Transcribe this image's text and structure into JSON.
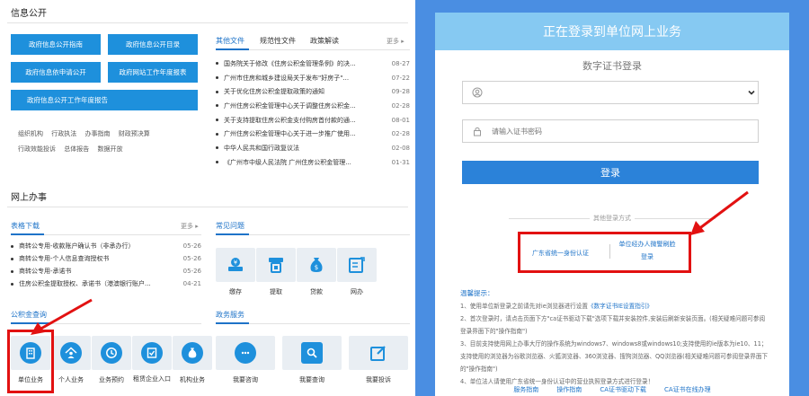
{
  "info_public": {
    "title": "信息公开",
    "buttons": [
      "政府信息公开指南",
      "政府信息公开目录",
      "政府信息依申请公开",
      "政府网站工作年度报表",
      "政府信息公开工作年度报告"
    ],
    "links_row1": [
      "组织机构",
      "行政执法",
      "办事指南",
      "财政预决算"
    ],
    "links_row2": [
      "行政效能投诉",
      "总体报告",
      "数据开放"
    ]
  },
  "news": {
    "tabs": [
      "其他文件",
      "规范性文件",
      "政策解读"
    ],
    "more": "更多 ▸",
    "items": [
      {
        "title": "国务院关于修改《住房公积金管理条例》的决...",
        "date": "08-27"
      },
      {
        "title": "广州市住房和城乡建设局关于发布\"好房子\"...",
        "date": "07-22"
      },
      {
        "title": "关于优化住房公积金提取政策的通知",
        "date": "09-28"
      },
      {
        "title": "广州住房公积金管理中心关于调整住房公积金...",
        "date": "02-28"
      },
      {
        "title": "关于支持提取住房公积金支付购房首付款的通...",
        "date": "08-01"
      },
      {
        "title": "广州住房公积金管理中心关于进一步推广使用...",
        "date": "02-28"
      },
      {
        "title": "中华人民共和国行政复议法",
        "date": "02-08"
      },
      {
        "title": "《广州市中级人民法院 广州住房公积金管理...",
        "date": "01-31"
      }
    ]
  },
  "online": {
    "title": "网上办事",
    "forms_tab": "表格下载",
    "faq_tab": "常见问题",
    "more": "更多 ▸",
    "forms": [
      {
        "title": "商转公专用-收款账户确认书（非承办行）",
        "date": "05-26"
      },
      {
        "title": "商转公专用-个人信息查询授权书",
        "date": "05-26"
      },
      {
        "title": "商转公专用-承诺书",
        "date": "05-26"
      },
      {
        "title": "住房公积金提取授权、承诺书（港澳银行账户...",
        "date": "04-21"
      }
    ],
    "faq": [
      "缴存",
      "提取",
      "贷款",
      "网办"
    ]
  },
  "gjj_query": {
    "title": "公积金查询",
    "items": [
      "单位业务",
      "个人业务",
      "业务预约",
      "租赁企业入口",
      "机构业务"
    ]
  },
  "gov_service": {
    "title": "政务服务",
    "items": [
      "我要咨询",
      "我要查询",
      "我要投诉"
    ]
  },
  "login": {
    "header": "正在登录到单位网上业务",
    "cert_title": "数字证书登录",
    "cert_placeholder": "",
    "pwd_placeholder": "请输入证书密码",
    "button": "登录",
    "other_title": "其他登录方式",
    "alt1": "广东省统一身份认证",
    "alt2_line1": "单位经办人微警刷脸",
    "alt2_line2": "登录",
    "tips_head": "温馨提示：",
    "tip1a": "1、使用单位新登录之前请先对ie浏览器进行设置",
    "tip1b": "《数字证书IE设置指引》",
    "tip2": "2、首次登录时，请点击页面下方\"ca证书驱动下载\"选项下载并安装控件,安装后刷新安装页面。(相关疑难问题可参阅登录界面下的\"操作指南\")",
    "tip3": "3、目前支持使用网上办事大厅的操作系统为windows7、windows8或windows10;支持使用的ie版本为ie10、11；支持使用的浏览器为谷歌浏览器、火狐浏览器、360浏览器、搜狗浏览器、QQ浏览器(相关疑难问题可参阅登录界面下的\"操作指南\")",
    "tip4": "4、单位法人请使用广东省统一身份认证中的营业执照登录方式进行登录！",
    "bottom_links": [
      "服务指南",
      "操作指南",
      "CA证书驱动下载",
      "CA证书在线办理"
    ]
  },
  "colors": {
    "accent": "#1e90dc",
    "header": "#86c9f2",
    "page_bg": "#4a8ee2",
    "highlight": "#e21111"
  }
}
